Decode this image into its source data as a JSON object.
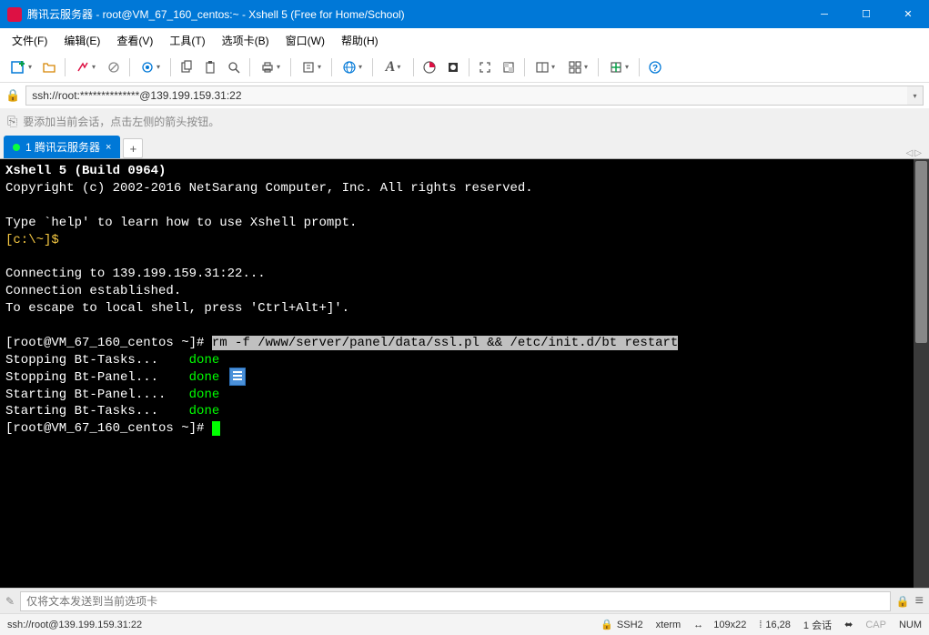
{
  "title": "腾讯云服务器 - root@VM_67_160_centos:~ - Xshell 5 (Free for Home/School)",
  "menus": {
    "file": "文件(F)",
    "edit": "编辑(E)",
    "view": "查看(V)",
    "tools": "工具(T)",
    "tabs": "选项卡(B)",
    "window": "窗口(W)",
    "help": "帮助(H)"
  },
  "address": "ssh://root:**************@139.199.159.31:22",
  "action_tip": "要添加当前会话，点击左侧的箭头按钮。",
  "tab": {
    "label": "1 腾讯云服务器"
  },
  "terminal": {
    "line1": "Xshell 5 (Build 0964)",
    "line2": "Copyright (c) 2002-2016 NetSarang Computer, Inc. All rights reserved.",
    "line3": "Type `help' to learn how to use Xshell prompt.",
    "prompt_local": "[c:\\~]$",
    "line4": "Connecting to 139.199.159.31:22...",
    "line5": "Connection established.",
    "line6": "To escape to local shell, press 'Ctrl+Alt+]'.",
    "prompt1": "[root@VM_67_160_centos ~]# ",
    "cmd_sel": "rm -f /www/server/panel/data/ssl.pl && /etc/init.d/bt restart",
    "stop_tasks": "Stopping Bt-Tasks...    ",
    "stop_panel": "Stopping Bt-Panel...    ",
    "start_panel": "Starting Bt-Panel....   ",
    "start_tasks": "Starting Bt-Tasks...    ",
    "done": "done",
    "prompt2": "[root@VM_67_160_centos ~]# "
  },
  "input_placeholder": "仅将文本发送到当前选项卡",
  "status": {
    "conn": "ssh://root@139.199.159.31:22",
    "proto": "SSH2",
    "term": "xterm",
    "size": "109x22",
    "pos": "16,28",
    "sessions": "1 会话",
    "cap": "CAP",
    "num": "NUM"
  }
}
